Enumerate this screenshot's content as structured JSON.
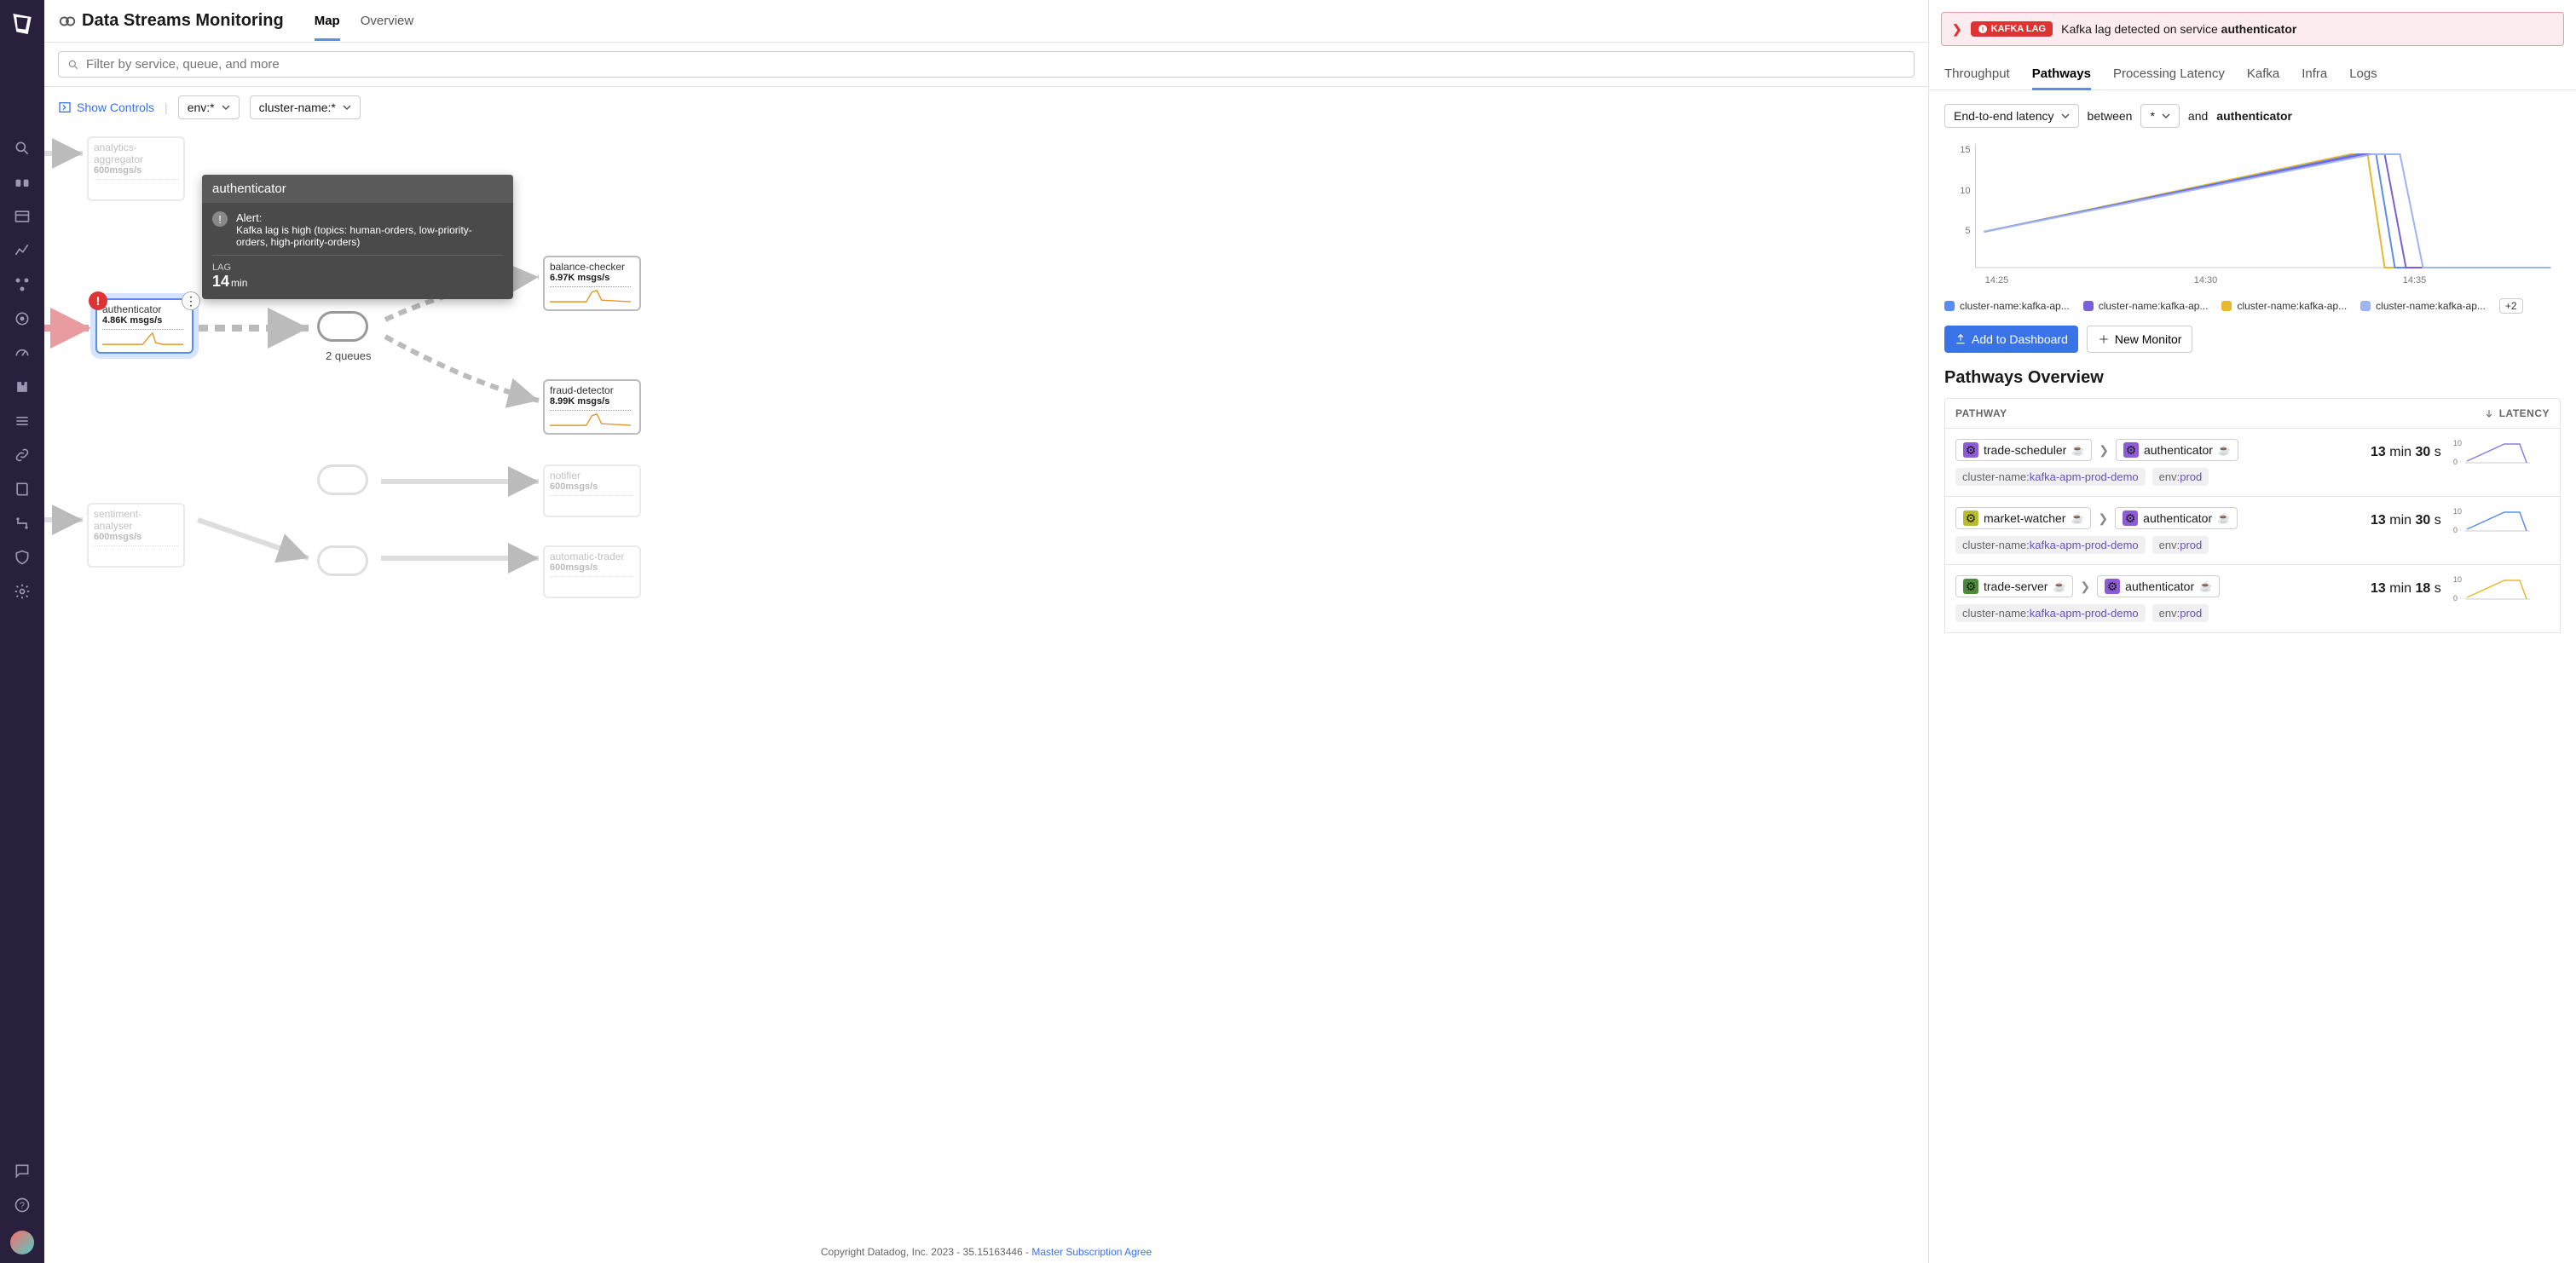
{
  "header": {
    "title": "Data Streams Monitoring"
  },
  "topTabs": [
    "Map",
    "Overview"
  ],
  "activeTopTab": 0,
  "filter": {
    "placeholder": "Filter by service, queue, and more"
  },
  "controls": {
    "showControls": "Show Controls",
    "envChip": "env:*",
    "clusterChip": "cluster-name:*"
  },
  "mapNodes": {
    "analyticsAggregator": {
      "title": "analytics-aggregator",
      "rate": "600msgs/s"
    },
    "authenticator": {
      "title": "authenticator",
      "rate": "4.86K msgs/s"
    },
    "balanceChecker": {
      "title": "balance-checker",
      "rate": "6.97K msgs/s"
    },
    "fraudDetector": {
      "title": "fraud-detector",
      "rate": "8.99K msgs/s"
    },
    "notifier": {
      "title": "notifier",
      "rate": "600msgs/s"
    },
    "automaticTrader": {
      "title": "automatic-trader",
      "rate": "600msgs/s"
    },
    "sentimentAnalyser": {
      "title": "sentiment-analyser",
      "rate": "600msgs/s"
    },
    "queueLabel": "2 queues"
  },
  "tooltip": {
    "title": "authenticator",
    "alertLabel": "Alert:",
    "alertText": "Kafka lag is high (topics: human-orders,  low-priority-orders, high-priority-orders)",
    "lagLabel": "LAG",
    "lagValue": "14",
    "lagUnit": "min"
  },
  "footer": {
    "copy": "Copyright Datadog, Inc. 2023 - 35.15163446 - ",
    "link": "Master Subscription Agree"
  },
  "alertBanner": {
    "pill": "KAFKA LAG",
    "textPrefix": "Kafka lag detected on service ",
    "service": "authenticator"
  },
  "panelTabs": [
    "Throughput",
    "Pathways",
    "Processing Latency",
    "Kafka",
    "Infra",
    "Logs"
  ],
  "activePanelTab": 1,
  "latency": {
    "metric": "End-to-end latency",
    "between": "between",
    "wildcard": "*",
    "and": "and",
    "target": "authenticator"
  },
  "chart_data": {
    "type": "line",
    "x": [
      "14:25",
      "14:30",
      "14:35"
    ],
    "ylim": [
      0,
      15
    ],
    "yticks": [
      5,
      10,
      15
    ],
    "series": [
      {
        "name": "cluster-name:kafka-ap...",
        "color": "#5b8def",
        "values": [
          5,
          14,
          0
        ]
      },
      {
        "name": "cluster-name:kafka-ap...",
        "color": "#7a5fd6",
        "values": [
          5,
          14,
          0
        ]
      },
      {
        "name": "cluster-name:kafka-ap...",
        "color": "#e8b92e",
        "values": [
          5,
          14,
          0
        ]
      },
      {
        "name": "cluster-name:kafka-ap...",
        "color": "#9db4f0",
        "values": [
          5,
          14,
          0
        ]
      }
    ],
    "legendOverflow": "+2"
  },
  "buttons": {
    "addDash": "Add to Dashboard",
    "newMon": "New Monitor"
  },
  "pathwaysTitle": "Pathways Overview",
  "pathwayCols": {
    "path": "PATHWAY",
    "latency": "LATENCY"
  },
  "pathways": [
    {
      "from": "trade-scheduler",
      "to": "authenticator",
      "iconFrom": "purple",
      "clusterTag": {
        "k": "cluster-name:",
        "v": "kafka-apm-prod-demo"
      },
      "envTag": {
        "k": "env:",
        "v": "prod"
      },
      "latency": {
        "v1": "13",
        "u1": "min",
        "v2": "30",
        "u2": "s"
      },
      "color": "#8a7fe0"
    },
    {
      "from": "market-watcher",
      "to": "authenticator",
      "iconFrom": "olive",
      "clusterTag": {
        "k": "cluster-name:",
        "v": "kafka-apm-prod-demo"
      },
      "envTag": {
        "k": "env:",
        "v": "prod"
      },
      "latency": {
        "v1": "13",
        "u1": "min",
        "v2": "30",
        "u2": "s"
      },
      "color": "#5b8def"
    },
    {
      "from": "trade-server",
      "to": "authenticator",
      "iconFrom": "dgreen",
      "clusterTag": {
        "k": "cluster-name:",
        "v": "kafka-apm-prod-demo"
      },
      "envTag": {
        "k": "env:",
        "v": "prod"
      },
      "latency": {
        "v1": "13",
        "u1": "min",
        "v2": "18",
        "u2": "s"
      },
      "color": "#e8b92e"
    }
  ]
}
